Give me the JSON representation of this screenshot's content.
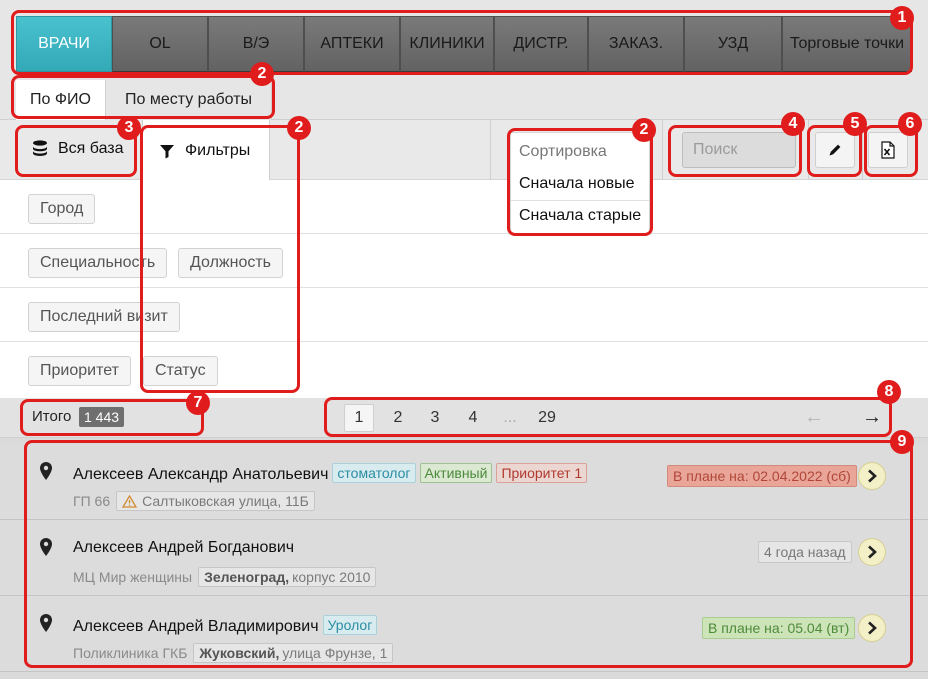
{
  "top_tabs": [
    {
      "label": "ВРАЧИ",
      "active": true
    },
    {
      "label": "OL"
    },
    {
      "label": "В/Э"
    },
    {
      "label": "АПТЕКИ"
    },
    {
      "label": "КЛИНИКИ"
    },
    {
      "label": "ДИСТР."
    },
    {
      "label": "ЗАКАЗ."
    },
    {
      "label": "УЗД"
    },
    {
      "label": "Торговые точки"
    }
  ],
  "sub_tabs": [
    {
      "label": "По ФИО",
      "active": true
    },
    {
      "label": "По месту работы"
    }
  ],
  "toolbar": {
    "all_base_label": "Вся база",
    "filters_label": "Фильтры",
    "search_placeholder": "Поиск"
  },
  "sort_menu": {
    "header": "Сортировка",
    "options": [
      "Сначала новые",
      "Сначала старые"
    ]
  },
  "filters": {
    "rows": [
      [
        "Город"
      ],
      [
        "Специальность",
        "Должность"
      ],
      [
        "Последний визит"
      ],
      [
        "Приоритет",
        "Статус"
      ]
    ]
  },
  "pager": {
    "total_label": "Итого",
    "total_count": "1 443",
    "pages": [
      "1",
      "2",
      "3",
      "4",
      "...",
      "29"
    ],
    "current_page": "1",
    "prev_arrow": "←",
    "next_arrow": "→"
  },
  "doctors": [
    {
      "name": "Алексеев Александр Анатольевич",
      "tags": [
        {
          "text": "стоматолог",
          "kind": "spec"
        },
        {
          "text": "Активный",
          "kind": "active"
        },
        {
          "text": "Приоритет 1",
          "kind": "prio"
        }
      ],
      "workplace": "ГП 66",
      "address_bold": "",
      "address": "Салтыковская улица, 11Б",
      "address_warning": true,
      "status": "В плане на: 02.04.2022 (сб)",
      "status_color": "red"
    },
    {
      "name": "Алексеев Андрей Богданович",
      "tags": [],
      "workplace": "МЦ Мир женщины",
      "address_bold": "Зеленоград,",
      "address": "корпус 2010",
      "address_warning": false,
      "status": "4 года назад",
      "status_color": "grey"
    },
    {
      "name": "Алексеев Андрей Владимирович",
      "tags": [
        {
          "text": "Уролог",
          "kind": "spec"
        }
      ],
      "workplace": "Поликлиника ГКБ",
      "address_bold": "Жуковский,",
      "address": "улица Фрунзе, 1",
      "address_warning": false,
      "status": "В плане на: 05.04 (вт)",
      "status_color": "green"
    }
  ],
  "annotations": [
    "1",
    "2",
    "2",
    "2",
    "3",
    "4",
    "5",
    "6",
    "7",
    "8",
    "9"
  ],
  "colors": {
    "accent": "#3fb6c4",
    "annotation": "#e01c1c"
  }
}
